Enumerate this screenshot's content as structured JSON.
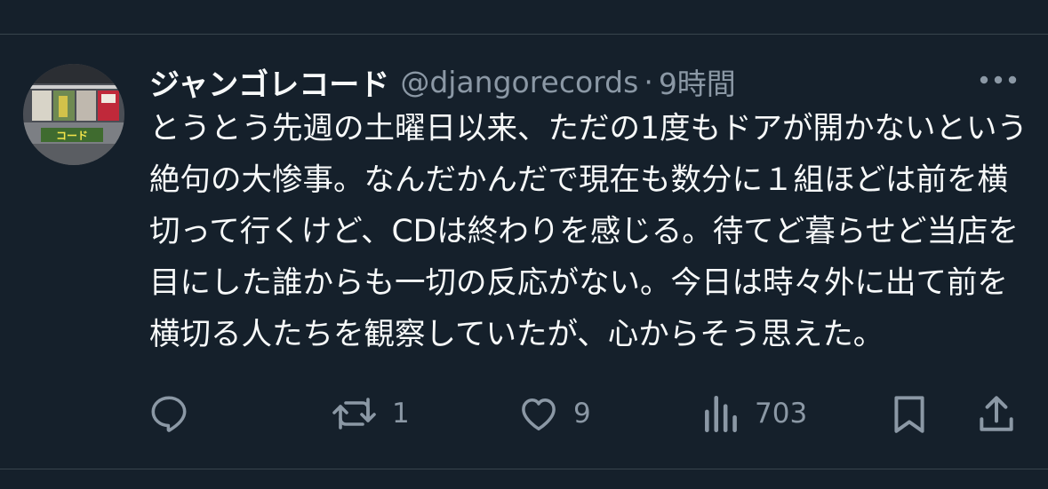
{
  "tweet": {
    "display_name": "ジャンゴレコード",
    "handle": "@djangorecords",
    "separator": "·",
    "time": "9時間",
    "text": "とうとう先週の土曜日以来、ただの1度もドアが開かないという絶句の大惨事。なんだかんだで現在も数分に１組ほどは前を横切って行くけど、CDは終わりを感じる。待てど暮らせど当店を目にした誰からも一切の反応がない。今日は時々外に出て前を横切る人たちを観察していたが、心からそう思えた。"
  },
  "actions": {
    "reply_count": "",
    "retweet_count": "1",
    "like_count": "9",
    "views_count": "703"
  },
  "avatar": {
    "sign_text": "コード"
  },
  "icons": {
    "more": "more-icon",
    "reply": "reply-icon",
    "retweet": "retweet-icon",
    "like": "heart-icon",
    "views": "views-icon",
    "bookmark": "bookmark-icon",
    "share": "share-icon"
  },
  "colors": {
    "background": "#15202b",
    "text_primary": "#f7f9f9",
    "text_secondary": "#8b98a5",
    "divider": "#38444d"
  }
}
